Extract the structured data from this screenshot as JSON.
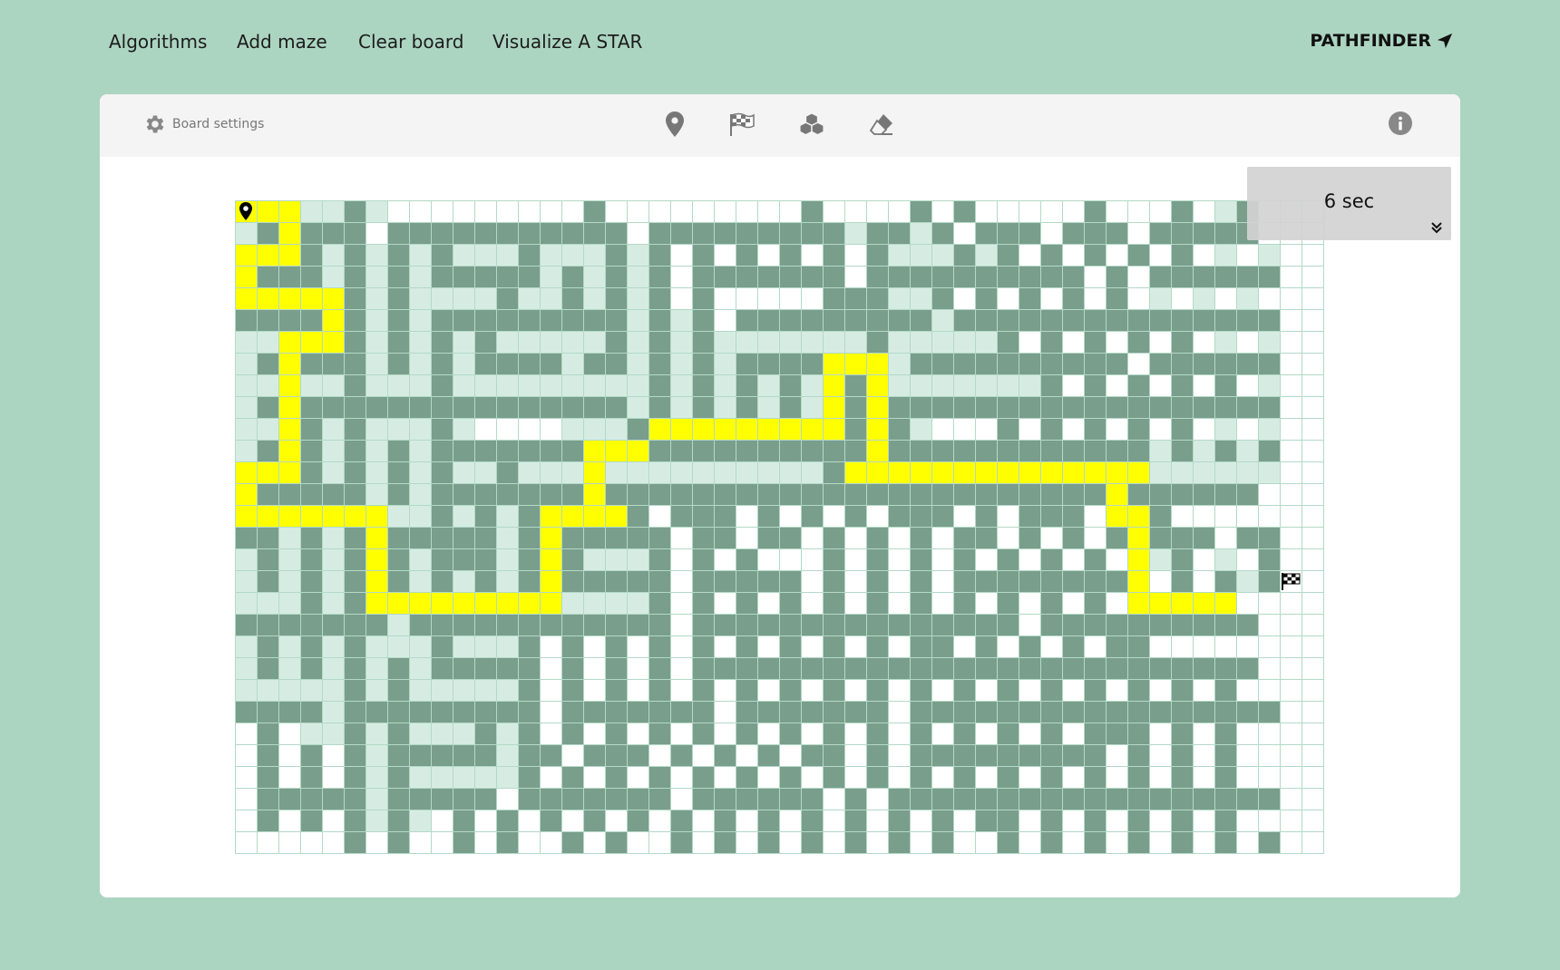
{
  "nav": {
    "items": [
      "Algorithms",
      "Add maze",
      "Clear board",
      "Visualize A STAR"
    ],
    "brand": "PATHFINDER"
  },
  "toolbar": {
    "settings_label": "Board settings",
    "tools": [
      "start-marker-icon",
      "finish-flag-icon",
      "weight-icon",
      "eraser-icon"
    ],
    "info_icon": "info-icon"
  },
  "timer": {
    "text": "6 sec"
  },
  "colors": {
    "page_bg": "#acd5c1",
    "wall": "#7a9e8c",
    "visited": "#d6ece2",
    "path": "#ffff00",
    "empty": "#ffffff",
    "grid_line": "#b3d9c7"
  },
  "board": {
    "rows": 30,
    "cols": 50,
    "start": [
      0,
      0
    ],
    "end": [
      17,
      48
    ],
    "legend": "W = wall, V = visited, P = path, . = empty",
    "cells": [
      "SPPVVWV.........W.........W....W.W.....W...W.VW.",
      "VWPWWW.WWWWWWWWWWW.WWWWWWWWWVWWVW.WWW.WWW.WWWWW.",
      "PPPWVWVWVWVVVWVVVWVW.W.W.W.W.WVVVWVW.W.W.W.W.V.V",
      "PWWWVWVWVWWWWWVWVWVW.WWWWWWW.WWWWWWWWWW.W.WWWWWW",
      "PPPPPWVWVVVVWVVWVWVW.W.....WWWVVW.W.W.W.W.V.V.V.",
      "WWWWPWVWVWWWWWWWWWVWVW.WWWWWWWWWVWWWWWWWWWWWWWWW",
      "VVPPPWVWVWVWVVVVVWVWVWVVVVVVVWVVVVVW.W.W.W.W.V.V",
      "VWPWWWVWVWVWWWWVWWVWVWVWWWWPPPVWWWWWWWWWW.WWWWWW",
      "VVPVVWVVVWVVVVVVVVVWVWVWVWVPWPVVVVVVVW.W.W.W.W.V",
      "VWPWWWWWWWWWWWWWWWVWVWVWVWVPWPWWWWWWWWWWWWWWWWWW",
      "VVPWVWVVVWV....VVVWPPPPPPPPPWPWV...W.W.W.W.W.V.V",
      "VWPWVWVWVWWWWWWWPPPWWWWWWWWWWPWWWWWWWWWWWWVWVWVW",
      "PPPWVWVWVWVVWVVVPVVVVVVVVVVWPPPPPPPPPPPPPPVVVVVV",
      "PWWWWWVWVWWWWWWWPWWWWWWWWWWWWWWWWWWWWWWWPWWWWWW.",
      "PPPPPPPVVWVWVWPPPPW.WWW.W.W.W.WWW.W.WWW.PPW.....",
      "WWVWVWPWWWWWVWPWWWWW.WW.WW.W.W.W.WW.W.W.WPWWW.WW",
      "VWVWVWPWVWWWVWPWVVVW.W.W...W.W.W.W.W.W.W.PVW.V.W",
      "VWVWVWPWVWVWVWPWWWWW.WWWWW.W.W.W.WWWWWWWWP.W.WVW",
      "VVVWVWPPPPPPPPPVVVVW.W.W.W.W.W.W.W.W.W.W.PPPPP.",
      "WWWWWWWVWWWWWWWWWWWW.WWWWWWWWWWWWWWW.WWWWWWWWWW",
      "VWVWVWVVVWVVVW.W.W.W.W.W.W.W.W.WW.W.W.W.WW.....",
      "VWVWVWVWVWWWWW.W.W.W.WWWWWWWWWWWWWWWWWWWWWWWWWW.",
      "VVVVVWVWVVVVVW.W.W.W.W.W.W.W.W.W.W.W.W.W.W.W.W.",
      "WWWWVWWWWWWWWW.WWWWWWW.WWWWWWW.WWWWWWWWWWWWWWWWW",
      ".W.VVWVWVVVWVW.W.W.W.W.W.W.W.W.W.W.W.W.WWW.W.W..",
      ".W.W.WVWWWWWVWW.WWW.W.W.W.WW.W.WWWWWWWWW.W.W.W..",
      ".W.W.WVWVVVVVW.W.W.W.W.W.W.W.W.W.W.W.W.W.W.W.W..",
      ".WWWWWVWWWWW.WWWWWWW.WWWWWW.W.WWWWWWWWWWWWWWWWWW",
      ".W.W.WVWV.W.W.W.W.W.W.W.W.W.W.W.W.WW.W.W.W.W.W.",
      ".....W.W..W.W..W.W..W.W.W.W.W.W.W..W.W.W.W.W.W.W"
    ]
  }
}
